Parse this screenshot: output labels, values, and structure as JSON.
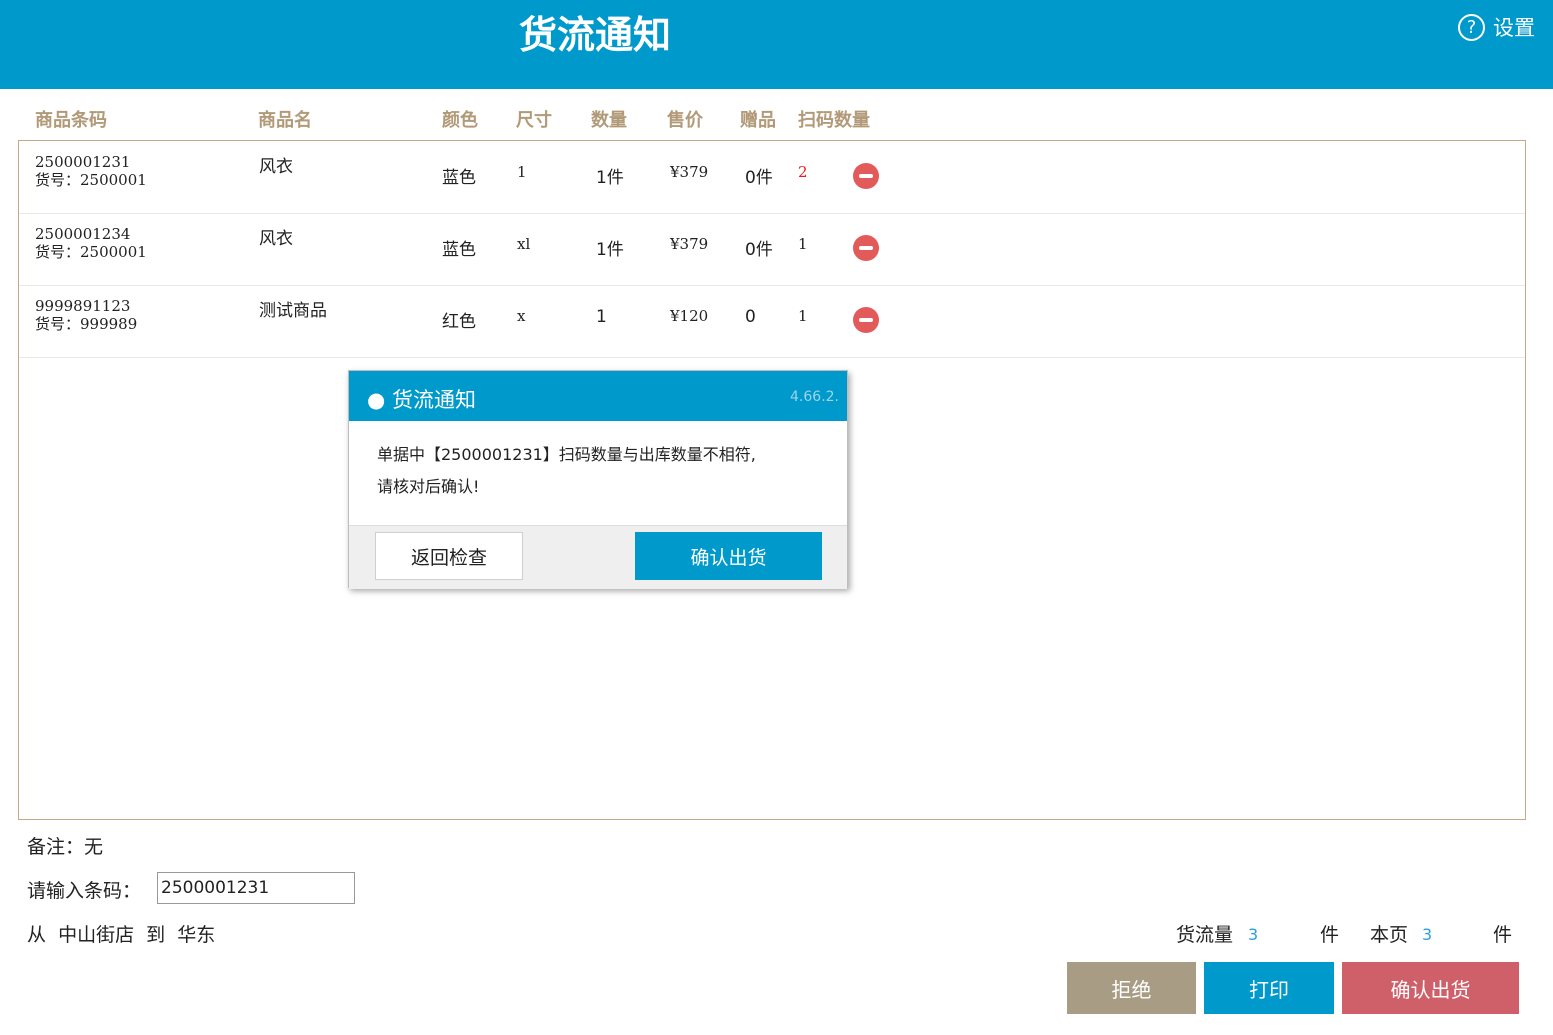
{
  "header": {
    "title": "货流通知",
    "settings_label": "设置",
    "help_symbol": "?"
  },
  "columns": [
    "商品条码",
    "商品名",
    "颜色",
    "尺寸",
    "数量",
    "售价",
    "赠品",
    "扫码数量"
  ],
  "rows": [
    {
      "barcode": "2500001231",
      "item_no": "货号：2500001",
      "name": "风衣",
      "color": "蓝色",
      "size": "1",
      "qty": "1件",
      "price": "¥379",
      "gift": "0件",
      "scanned": "2",
      "scanned_color": "#e02020"
    },
    {
      "barcode": "2500001234",
      "item_no": "货号：2500001",
      "name": "风衣",
      "color": "蓝色",
      "size": "xl",
      "qty": "1件",
      "price": "¥379",
      "gift": "0件",
      "scanned": "1",
      "scanned_color": "#222222"
    },
    {
      "barcode": "9999891123",
      "item_no": "货号：999989",
      "name": "测试商品",
      "color": "红色",
      "size": "x",
      "qty": "1",
      "price": "¥120",
      "gift": "0",
      "scanned": "1",
      "scanned_color": "#222222"
    }
  ],
  "dialog": {
    "title": "● 货流通知",
    "version": "4.66.2.",
    "message_line1": "单据中【2500001231】扫码数量与出库数量不相符,",
    "message_line2": "请核对后确认!",
    "back_label": "返回检查",
    "confirm_label": "确认出货"
  },
  "footer": {
    "remark": "备注：无",
    "input_label": "请输入条码：",
    "input_value": "2500001231",
    "route": "从  中山街店  到  华东",
    "flow_label": "货流量",
    "flow_count": "3",
    "flow_unit": "件",
    "page_label": "本页",
    "page_count": "3",
    "page_unit": "件"
  },
  "buttons": {
    "reject": "拒绝",
    "print": "打印",
    "confirm": "确认出货"
  },
  "colors": {
    "header_blue": "#0099cc",
    "reject": "#a89c84",
    "print": "#0099cc",
    "confirm": "#cf5f69"
  }
}
